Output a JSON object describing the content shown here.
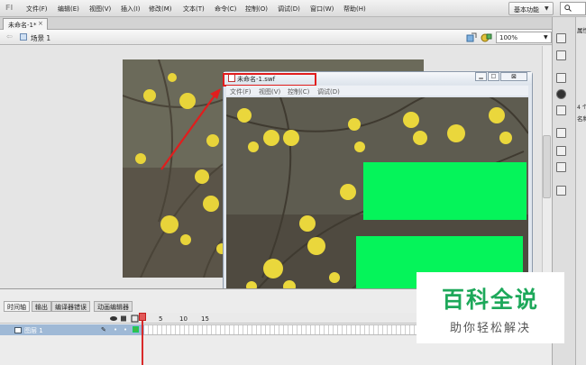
{
  "app": {
    "logo": "Fl"
  },
  "menu": [
    "文件(F)",
    "编辑(E)",
    "视图(V)",
    "插入(I)",
    "修改(M)",
    "文本(T)",
    "命令(C)",
    "控制(O)",
    "调试(D)",
    "窗口(W)",
    "帮助(H)"
  ],
  "workspace": {
    "label": "基本功能"
  },
  "search": {
    "icon": "search-icon"
  },
  "doc_tab": {
    "title": "未命名-1*",
    "close": "×"
  },
  "editbar": {
    "scene": "场景 1",
    "zoom": "100%"
  },
  "timeline": {
    "tabs": [
      "时间轴",
      "输出",
      "编译器错误",
      "动画编辑器"
    ],
    "frame_numbers": [
      "1",
      "5",
      "10",
      "15"
    ],
    "layer": "图层 1"
  },
  "swf": {
    "title": "未命名-1.swf",
    "menus": [
      "文件(F)",
      "视图(V)",
      "控制(C)",
      "调试(D)"
    ],
    "close": "⊠"
  },
  "panel": {
    "label": "属性",
    "label2": "名称",
    "num": "4 个"
  },
  "brand": {
    "title": "百科全说",
    "subtitle": "助你轻松解决"
  },
  "colors": {
    "green": "#05f45a",
    "highlight": "#e11d1d",
    "brand": "#1da85a"
  }
}
